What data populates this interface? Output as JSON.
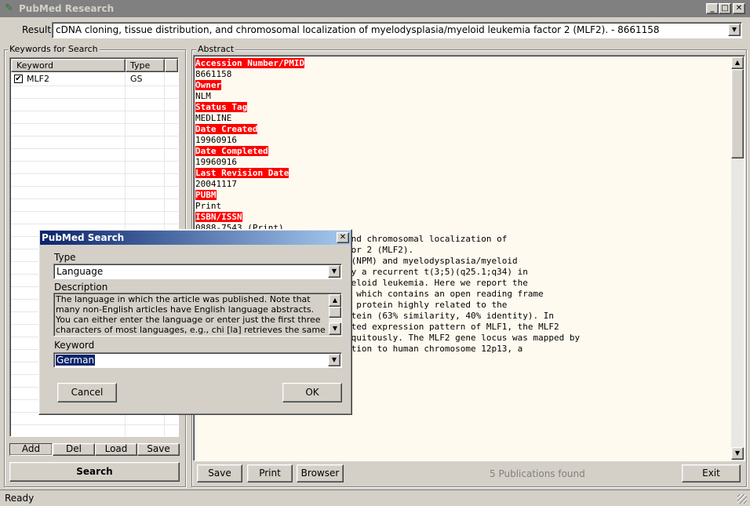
{
  "window": {
    "title": "PubMed Research",
    "minimize": "_",
    "maximize": "□",
    "close": "✕"
  },
  "results": {
    "label": "Results",
    "value": "cDNA cloning, tissue distribution, and chromosomal localization of myelodysplasia/myeloid leukemia factor 2 (MLF2). - 8661158"
  },
  "keywords_panel": {
    "legend": "Keywords for Search",
    "col_keyword": "Keyword",
    "col_type": "Type",
    "rows": [
      {
        "keyword": "MLF2",
        "type": "GS",
        "checked": true
      }
    ],
    "buttons": {
      "add": "Add",
      "del": "Del",
      "load": "Load",
      "save": "Save"
    },
    "search": "Search"
  },
  "abstract": {
    "legend": "Abstract",
    "lines": [
      {
        "text": "Accession Number/PMID",
        "tag": true
      },
      {
        "text": "8661158",
        "tag": false
      },
      {
        "text": "Owner",
        "tag": true
      },
      {
        "text": "NLM",
        "tag": false
      },
      {
        "text": "Status Tag",
        "tag": true
      },
      {
        "text": "MEDLINE",
        "tag": false
      },
      {
        "text": "Date Created",
        "tag": true
      },
      {
        "text": "19960916",
        "tag": false
      },
      {
        "text": "Date Completed",
        "tag": true
      },
      {
        "text": "19960916",
        "tag": false
      },
      {
        "text": "Last Revision Date",
        "tag": true
      },
      {
        "text": "20041117",
        "tag": false
      },
      {
        "text": "PUBM",
        "tag": true
      },
      {
        "text": "Print",
        "tag": false
      },
      {
        "text": "ISBN/ISSN",
        "tag": true
      },
      {
        "text": "0888-7543 (Print)",
        "tag": false
      },
      {
        "text": "",
        "tag": false
      },
      {
        "text": "",
        "tag": false
      },
      {
        "text": "",
        "tag": false
      },
      {
        "text": "",
        "tag": false
      },
      {
        "text": "",
        "tag": false
      },
      {
        "text": "",
        "tag": false
      },
      {
        "text": "                      ation, and chromosomal localization of",
        "tag": false
      },
      {
        "text": "                      aia factor 2 (MLF2).",
        "tag": false
      },
      {
        "text": "",
        "tag": false
      },
      {
        "text": "",
        "tag": false
      },
      {
        "text": "",
        "tag": false
      },
      {
        "text": "                      phosmin (NPM) and myelodysplasia/myeloid",
        "tag": false
      },
      {
        "text": "                      formed by a recurrent t(3;5)(q25.1;q34) in",
        "tag": false
      },
      {
        "text": "                      acute myeloid leukemia. Here we report the",
        "tag": false
      },
      {
        "text": "                      e, MLF2, which contains an open reading frame",
        "tag": false
      },
      {
        "text": "                      ino-acid protein highly related to the",
        "tag": false
      },
      {
        "text": "previously identified MLF1 protein (63% similarity, 40% identity). In",
        "tag": false
      },
      {
        "text": "contrast to the tissue-restricted expression pattern of MLF1, the MLF2",
        "tag": false
      },
      {
        "text": "messenger RNA is expressed ubiquitously. The MLF2 gene locus was mapped by",
        "tag": false
      },
      {
        "text": "fluorescence in situ hybridization to human chromosome 12p13, a",
        "tag": false
      }
    ]
  },
  "bottom": {
    "save": "Save",
    "print": "Print",
    "browser": "Browser",
    "status_count": "5 Publications found",
    "exit": "Exit"
  },
  "statusbar": {
    "text": "Ready"
  },
  "dialog": {
    "title": "PubMed Search",
    "type_label": "Type",
    "type_value": "Language",
    "desc_label": "Description",
    "description": "The language in which the article was published. Note that many non-English articles have English language abstracts. You can either enter the language or enter just the first three characters of most languages, e.g., chi [la] retrieves the same as chinese [la]. The most notable",
    "keyword_label": "Keyword",
    "keyword_value": "German",
    "cancel": "Cancel",
    "ok": "OK"
  }
}
